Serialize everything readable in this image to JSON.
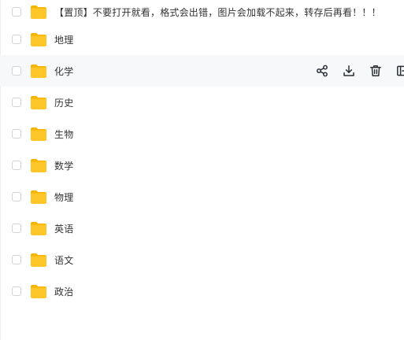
{
  "files": [
    {
      "name": "【置顶】不要打开就看，格式会出错，图片会加载不起来，转存后再看！！！"
    },
    {
      "name": "地理"
    },
    {
      "name": "化学"
    },
    {
      "name": "历史"
    },
    {
      "name": "生物"
    },
    {
      "name": "数学"
    },
    {
      "name": "物理"
    },
    {
      "name": "英语"
    },
    {
      "name": "语文"
    },
    {
      "name": "政治"
    }
  ],
  "row_actions": [
    {
      "icon": "share-icon"
    },
    {
      "icon": "download-icon"
    },
    {
      "icon": "delete-icon"
    },
    {
      "icon": "more-icon"
    }
  ],
  "colors": {
    "folder": "#FFC629",
    "folder_tab": "#F6B400",
    "hover_row": "#F7F8FA",
    "icon": "#2B2F36"
  }
}
